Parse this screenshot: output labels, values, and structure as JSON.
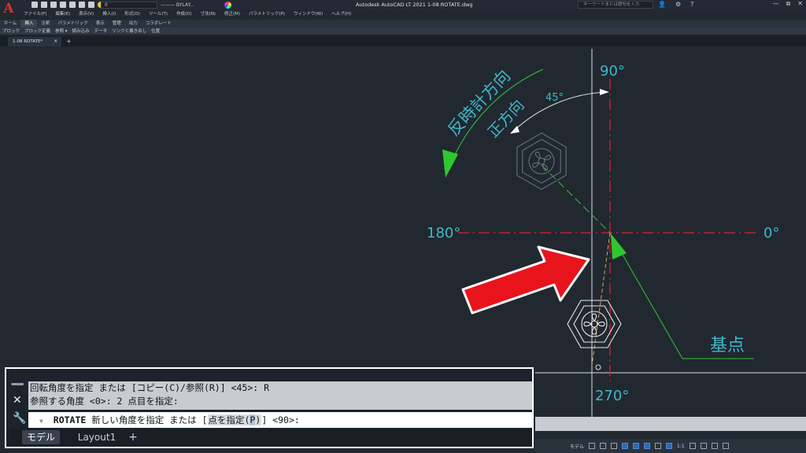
{
  "app": {
    "logo": "A",
    "title": "Autodesk AutoCAD LT 2021    1-08 ROTATE.dwg",
    "layer_value": "0",
    "linetype_value": "——— BYLAY...",
    "search_placeholder": "キーワードまたは語句を入力",
    "window_buttons": [
      "—",
      "⧉",
      "✕"
    ]
  },
  "menu": [
    "ファイル(F)",
    "編集(E)",
    "表示(V)",
    "挿入(I)",
    "形式(O)",
    "ツール(T)",
    "作成(D)",
    "寸法(N)",
    "修正(M)",
    "パラメトリック(P)",
    "ウィンドウ(W)",
    "ヘルプ(H)"
  ],
  "ribbon_tabs": [
    "ホーム",
    "挿入",
    "注釈",
    "パラメトリック",
    "表示",
    "管理",
    "出力",
    "コラボレート"
  ],
  "ribbon_active": 1,
  "ribbon_panels": [
    "ブロック",
    "ブロック定義",
    "参照 ▾",
    "読み込み",
    "データ",
    "リンクと書き出し",
    "位置"
  ],
  "doc_tab": {
    "label": "1-08 ROTATE*",
    "close": "✕",
    "new": "+"
  },
  "drawing": {
    "angle_90": "90°",
    "angle_180": "180°",
    "angle_0": "0°",
    "angle_270": "270°",
    "angle_45": "45°",
    "ccw_label": "反時計方向",
    "positive_label": "正方向",
    "base_point_label": "基点",
    "colors": {
      "axis_red": "#e0202a",
      "cyan": "#3fb8c8",
      "green": "#2ec82e",
      "arrow_red": "#e8141c",
      "background": "#212830"
    }
  },
  "command": {
    "history": [
      "回転角度を指定 または [コピー(C)/参照(R)] <45>: R",
      "参照する角度 <0>:  2 点目を指定:"
    ],
    "prompt_keyword": "ROTATE",
    "prompt_text": "新しい角度を指定 または [",
    "prompt_option": "点を指定(",
    "prompt_option_key": "P",
    "prompt_option_end": ")",
    "prompt_suffix": "] <90>:"
  },
  "layout_tabs": [
    "モデル",
    "Layout1",
    "+"
  ],
  "status": {
    "model": "モデル",
    "scale": "1:1"
  }
}
